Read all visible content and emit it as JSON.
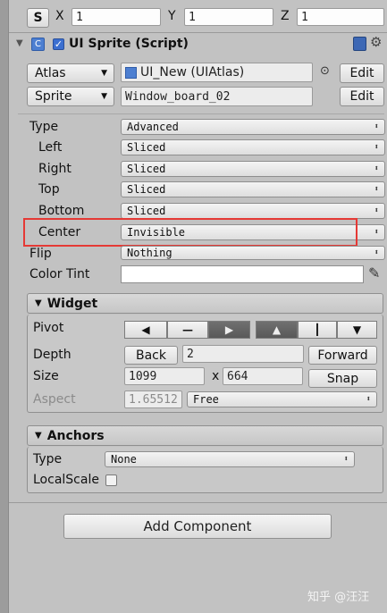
{
  "transform": {
    "s_label": "S",
    "x_label": "X",
    "x_value": "1",
    "y_label": "Y",
    "y_value": "1",
    "z_label": "Z",
    "z_value": "1"
  },
  "sprite_component": {
    "title": "UI Sprite (Script)",
    "atlas_label": "Atlas",
    "atlas_value": "UI_New (UIAtlas)",
    "sprite_label": "Sprite",
    "sprite_value": "Window_board_02",
    "edit_label": "Edit",
    "type_label": "Type",
    "type_value": "Advanced",
    "left_label": "Left",
    "left_value": "Sliced",
    "right_label": "Right",
    "right_value": "Sliced",
    "top_label": "Top",
    "top_value": "Sliced",
    "bottom_label": "Bottom",
    "bottom_value": "Sliced",
    "center_label": "Center",
    "center_value": "Invisible",
    "flip_label": "Flip",
    "flip_value": "Nothing",
    "color_tint_label": "Color Tint",
    "color_tint": "#ffffff",
    "highlight_color": "#e53935"
  },
  "widget": {
    "title": "Widget",
    "pivot_label": "Pivot",
    "depth_label": "Depth",
    "back_label": "Back",
    "depth_value": "2",
    "forward_label": "Forward",
    "size_label": "Size",
    "width": "1099",
    "x_sep": "x",
    "height": "664",
    "snap_label": "Snap",
    "aspect_label": "Aspect",
    "aspect_value": "1.65512",
    "aspect_mode": "Free"
  },
  "anchors": {
    "title": "Anchors",
    "type_label": "Type",
    "type_value": "None",
    "local_scale_label": "LocalScale"
  },
  "add_component_label": "Add Component",
  "watermark": "知乎 @汪汪"
}
